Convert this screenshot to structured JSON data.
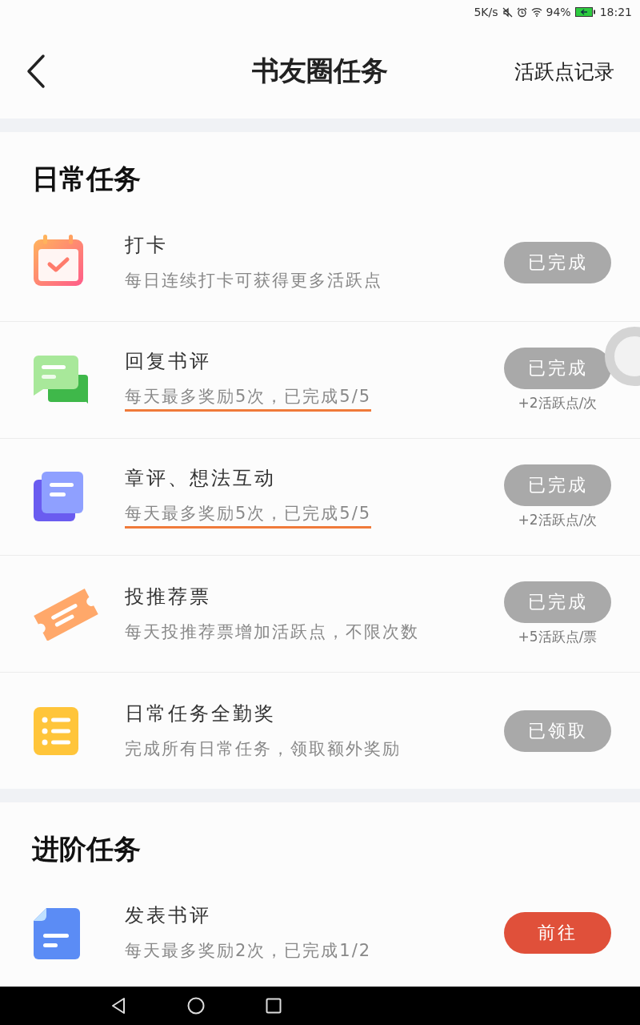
{
  "status_bar": {
    "speed": "5K/s",
    "battery_percent": "94%",
    "time": "18:21"
  },
  "header": {
    "title": "书友圈任务",
    "action": "活跃点记录"
  },
  "sections": [
    {
      "title": "日常任务",
      "tasks": [
        {
          "kind": "calendar",
          "title": "打卡",
          "subtitle": "每日连续打卡可获得更多活跃点",
          "underlined": false,
          "button": {
            "label": "已完成",
            "kind": "done"
          }
        },
        {
          "kind": "chat",
          "title": "回复书评",
          "subtitle": "每天最多奖励5次，已完成5/5",
          "underlined": true,
          "button": {
            "label": "已完成",
            "kind": "done"
          },
          "reward": "+2活跃点/次"
        },
        {
          "kind": "notes",
          "title": "章评、想法互动",
          "subtitle": "每天最多奖励5次，已完成5/5",
          "underlined": true,
          "button": {
            "label": "已完成",
            "kind": "done"
          },
          "reward": "+2活跃点/次"
        },
        {
          "kind": "ticket",
          "title": "投推荐票",
          "subtitle": "每天投推荐票增加活跃点，不限次数",
          "underlined": false,
          "button": {
            "label": "已完成",
            "kind": "done"
          },
          "reward": "+5活跃点/票"
        },
        {
          "kind": "list",
          "title": "日常任务全勤奖",
          "subtitle": "完成所有日常任务，领取额外奖励",
          "underlined": false,
          "button": {
            "label": "已领取",
            "kind": "done"
          }
        }
      ]
    },
    {
      "title": "进阶任务",
      "tasks": [
        {
          "kind": "document",
          "title": "发表书评",
          "subtitle": "每天最多奖励2次，已完成1/2",
          "underlined": false,
          "button": {
            "label": "前往",
            "kind": "go"
          }
        }
      ]
    }
  ]
}
